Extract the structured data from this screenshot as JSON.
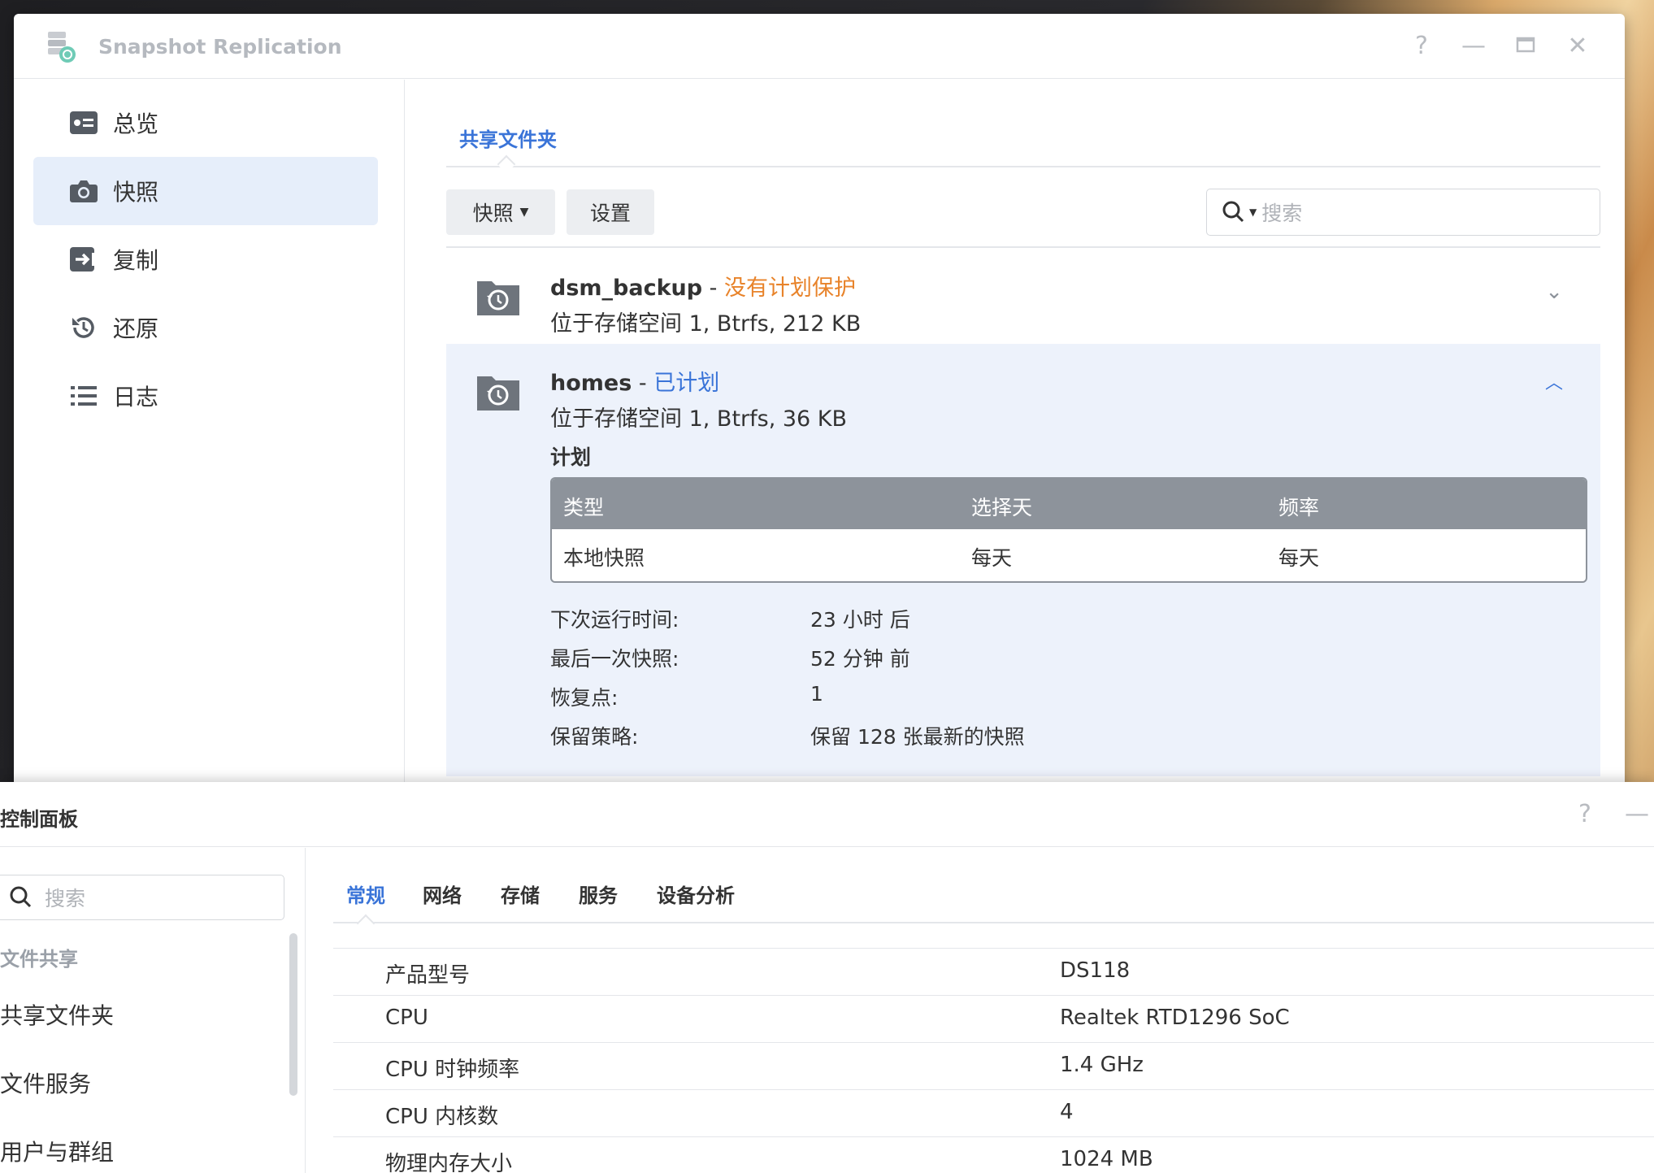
{
  "snapshot_window": {
    "title": "Snapshot Replication",
    "sidebar": [
      {
        "label": "总览",
        "icon": "overview-icon"
      },
      {
        "label": "快照",
        "icon": "camera-icon",
        "active": true
      },
      {
        "label": "复制",
        "icon": "replication-icon"
      },
      {
        "label": "还原",
        "icon": "restore-icon"
      },
      {
        "label": "日志",
        "icon": "log-list-icon"
      }
    ],
    "tab": "共享文件夹",
    "toolbar": {
      "snapshot_label": "快照",
      "settings_label": "设置",
      "search_placeholder": "搜索"
    },
    "folders": [
      {
        "name": "dsm_backup",
        "separator": " - ",
        "status": "没有计划保护",
        "status_color": "#e8832a",
        "location": "位于存储空间 1, Btrfs, 212 KB",
        "expanded": false
      },
      {
        "name": "homes",
        "separator": " - ",
        "status": "已计划",
        "status_color": "#3a74d8",
        "location": "位于存储空间 1, Btrfs, 36 KB",
        "expanded": true,
        "plan_title": "计划",
        "plan_table": {
          "headers": [
            "类型",
            "选择天",
            "频率"
          ],
          "rows": [
            [
              "本地快照",
              "每天",
              "每天"
            ]
          ]
        },
        "details": [
          {
            "label": "下次运行时间:",
            "value": "23 小时 后"
          },
          {
            "label": "最后一次快照:",
            "value": "52 分钟 前"
          },
          {
            "label": "恢复点:",
            "value": "1"
          },
          {
            "label": "保留策略:",
            "value": "保留 128 张最新的快照"
          }
        ]
      }
    ]
  },
  "control_panel": {
    "title": "控制面板",
    "search_placeholder": "搜索",
    "section": "文件共享",
    "sidebar_items": [
      "共享文件夹",
      "文件服务",
      "用户与群组"
    ],
    "tabs": [
      "常规",
      "网络",
      "存储",
      "服务",
      "设备分析"
    ],
    "active_tab": "常规",
    "info": [
      {
        "label": "产品型号",
        "value": "DS118"
      },
      {
        "label": "CPU",
        "value": "Realtek RTD1296 SoC"
      },
      {
        "label": "CPU 时钟频率",
        "value": "1.4 GHz"
      },
      {
        "label": "CPU 内核数",
        "value": "4"
      },
      {
        "label": "物理内存大小",
        "value": "1024 MB"
      }
    ]
  },
  "colors": {
    "accent": "#3a74d8",
    "warning": "#e8832a",
    "active_bg": "#e6eefa",
    "expanded_bg": "#edf2fb",
    "table_header": "#8d939b"
  }
}
